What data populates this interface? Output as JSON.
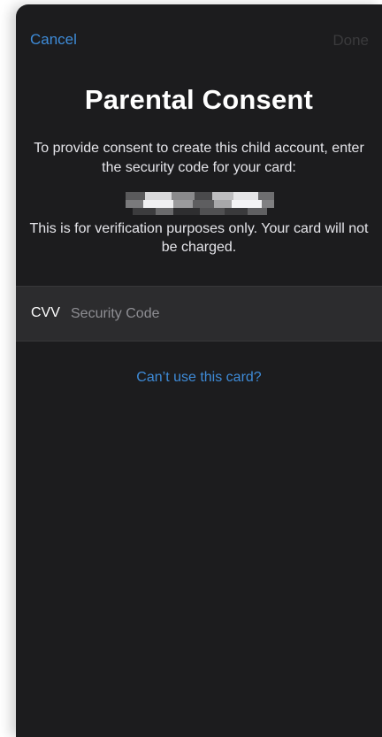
{
  "nav": {
    "cancel_label": "Cancel",
    "done_label": "Done"
  },
  "page": {
    "title": "Parental Consent",
    "instructions": "To provide consent to create this child account, enter the security code for your card:",
    "note": "This is for verification purposes only. Your card will not be charged."
  },
  "cvv": {
    "label": "CVV",
    "placeholder": "Security Code",
    "value": ""
  },
  "links": {
    "cant_use_card": "Can’t use this card?"
  },
  "colors": {
    "background": "#1c1c1e",
    "row_background": "#2c2c2e",
    "accent": "#3e8bd8",
    "disabled": "#3a3a3c",
    "text": "#ffffff",
    "secondary_text": "#e5e5ea",
    "placeholder": "#8e8e93"
  }
}
